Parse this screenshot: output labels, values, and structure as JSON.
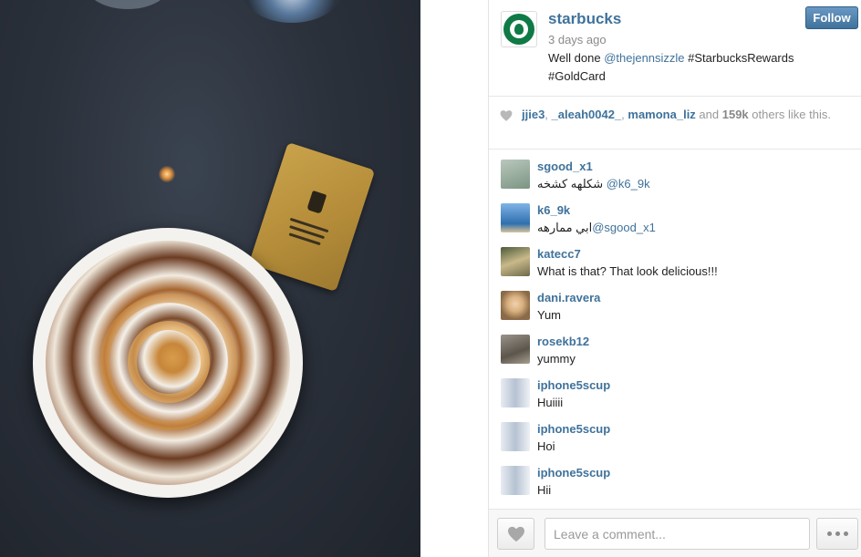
{
  "post": {
    "username": "starbucks",
    "time": "3 days ago",
    "caption_prefix": " Well done ",
    "caption_mention": "@thejennsizzle",
    "caption_tags": " #StarbucksRewards #GoldCard",
    "follow_label": "Follow"
  },
  "likes": {
    "users": [
      "jjie3",
      "_aleah0042_",
      "mamona_liz"
    ],
    "sep1": ", ",
    "sep2": ", ",
    "and_text": " and ",
    "count": "159k",
    "suffix": " others like this."
  },
  "comments": [
    {
      "user": "sgood_x1",
      "text": "شكلهه كشخه ",
      "mention": "@k6_9k",
      "avatar_color": "#8aa090"
    },
    {
      "user": "k6_9k",
      "text": "ابي ممارهه",
      "mention": "@sgood_x1",
      "avatar_color": "#3e7bbf"
    },
    {
      "user": "katecc7",
      "text": "What is that? That look delicious!!!",
      "mention": "",
      "avatar_color": "#9a8a60"
    },
    {
      "user": "dani.ravera",
      "text": "Yum",
      "mention": "",
      "avatar_color": "#c9a27a"
    },
    {
      "user": "rosekb12",
      "text": "yummy",
      "mention": "",
      "avatar_color": "#7d7468"
    },
    {
      "user": "iphone5scup",
      "text": "Huiiii",
      "mention": "",
      "avatar_color": "#cfd6e0"
    },
    {
      "user": "iphone5scup",
      "text": "Hoi",
      "mention": "",
      "avatar_color": "#cfd6e0"
    },
    {
      "user": "iphone5scup",
      "text": "Hii",
      "mention": "",
      "avatar_color": "#cfd6e0"
    }
  ],
  "footer": {
    "comment_placeholder": "Leave a comment..."
  },
  "colors": {
    "link": "#3f729b",
    "brand_green": "#0f7a45"
  }
}
